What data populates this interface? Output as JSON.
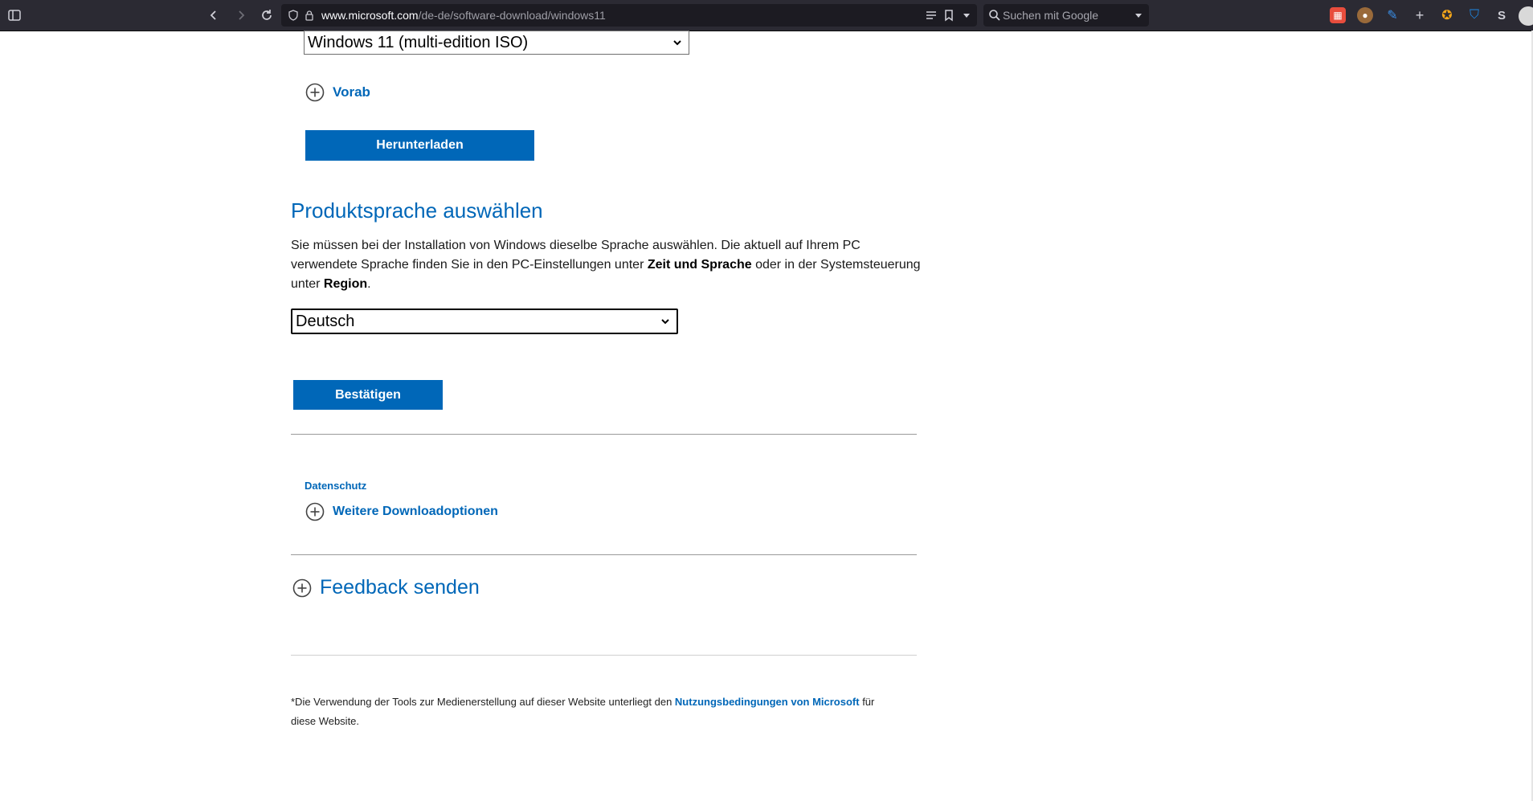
{
  "browser": {
    "url_domain": "www.microsoft.com",
    "url_path": "/de-de/software-download/windows11",
    "search_placeholder": "Suchen mit Google",
    "extensions": [
      {
        "name": "multi-account-icon",
        "color": "#e84d3d"
      },
      {
        "name": "cookie-icon",
        "color": "#9a6a3a"
      },
      {
        "name": "pen-icon",
        "color": "#3a8ee6"
      },
      {
        "name": "plus-icon",
        "color": "#d0d0d8"
      },
      {
        "name": "medal-icon",
        "color": "#f2a51a"
      },
      {
        "name": "shield-ext-icon",
        "color": "#1e88e5"
      },
      {
        "name": "s-ext-icon",
        "color": "#d0d0d8"
      }
    ]
  },
  "edition": {
    "selected": "Windows 11 (multi-edition ISO)",
    "vorab_label": "Vorab",
    "download_button": "Herunterladen"
  },
  "language": {
    "heading": "Produktsprache auswählen",
    "para_1": "Sie müssen bei der Installation von Windows dieselbe Sprache auswählen. Die aktuell auf Ihrem PC verwendete Sprache finden Sie in den PC-Einstellungen unter ",
    "para_bold_1": "Zeit und Sprache",
    "para_2": " oder in der Systemsteuerung unter ",
    "para_bold_2": "Region",
    "para_3": ".",
    "selected": "Deutsch",
    "confirm_button": "Bestätigen"
  },
  "links": {
    "privacy": "Datenschutz",
    "more_options": "Weitere Downloadoptionen",
    "feedback": "Feedback senden"
  },
  "footnote": {
    "text_1": "*Die Verwendung der Tools zur Medienerstellung auf dieser Website unterliegt den ",
    "link": "Nutzungsbedingungen von Microsoft",
    "text_2": " für diese Website."
  },
  "colors": {
    "accent": "#0067b8",
    "toolbar": "#2b2a33",
    "urlbar": "#1c1b22"
  }
}
